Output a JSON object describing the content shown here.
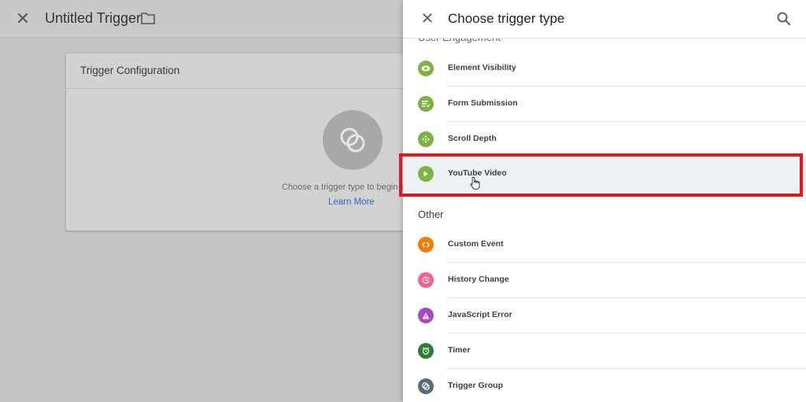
{
  "background": {
    "title": "Untitled Trigger",
    "card_title": "Trigger Configuration",
    "hint_text": "Choose a trigger type to begin s",
    "learn_more": "Learn More"
  },
  "panel": {
    "title": "Choose trigger type",
    "partial_section": "User Engagement",
    "other_section": "Other",
    "user_engagement_items": [
      {
        "label": "Element Visibility",
        "icon": "eye-icon",
        "color": "#7cb342"
      },
      {
        "label": "Form Submission",
        "icon": "form-icon",
        "color": "#7cb342"
      },
      {
        "label": "Scroll Depth",
        "icon": "scroll-icon",
        "color": "#7cb342"
      },
      {
        "label": "YouTube Video",
        "icon": "play-icon",
        "color": "#7cb342",
        "selected": true
      }
    ],
    "other_items": [
      {
        "label": "Custom Event",
        "icon": "code-icon",
        "color": "#f57c00"
      },
      {
        "label": "History Change",
        "icon": "history-icon",
        "color": "#f06292"
      },
      {
        "label": "JavaScript Error",
        "icon": "warning-icon",
        "color": "#ab47bc"
      },
      {
        "label": "Timer",
        "icon": "timer-icon",
        "color": "#2e7d32"
      },
      {
        "label": "Trigger Group",
        "icon": "group-icon",
        "color": "#546e7a"
      }
    ]
  },
  "colors": {
    "highlight": "#e0191f",
    "link": "#2d6bb5"
  }
}
